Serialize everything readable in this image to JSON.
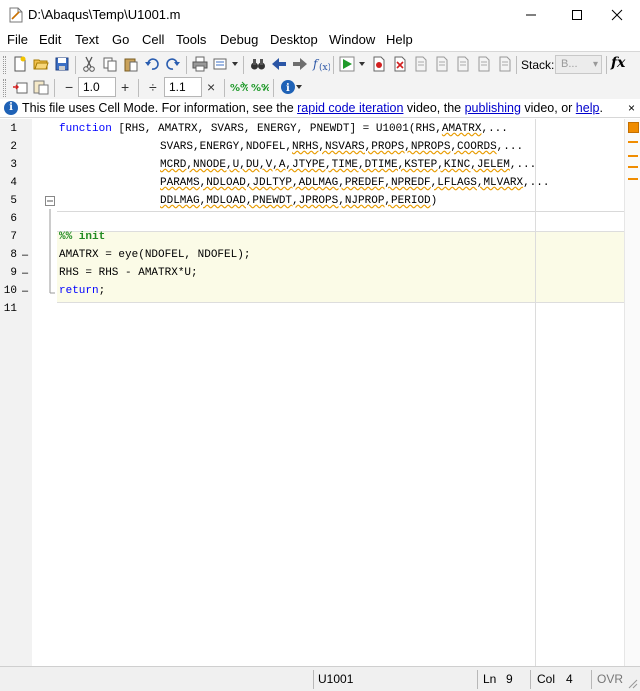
{
  "window": {
    "title": "D:\\Abaqus\\Temp\\U1001.m"
  },
  "menubar": [
    {
      "label": "File"
    },
    {
      "label": "Edit"
    },
    {
      "label": "Text"
    },
    {
      "label": "Go"
    },
    {
      "label": "Cell"
    },
    {
      "label": "Tools"
    },
    {
      "label": "Debug"
    },
    {
      "label": "Desktop"
    },
    {
      "label": "Window"
    },
    {
      "label": "Help"
    }
  ],
  "toolbar": {
    "stack_label": "Stack:",
    "stack_value": "B...",
    "fx_label": "fx"
  },
  "cell_toolbar": {
    "minus": "−",
    "field1": "1.0",
    "plus": "+",
    "divide": "÷",
    "field2": "1.1",
    "times": "×"
  },
  "infobar": {
    "text_prefix": "This file uses Cell Mode. For information, see the ",
    "link1": "rapid code iteration",
    "text_mid1": " video, the ",
    "link2": "publishing",
    "text_mid2": " video, or ",
    "link3": "help",
    "text_suffix": ".",
    "close": "×"
  },
  "editor": {
    "line_numbers": [
      "1",
      "2",
      "3",
      "4",
      "5",
      "6",
      "7",
      "8",
      "9",
      "10",
      "11"
    ],
    "lines": {
      "l1_kw": "function",
      "l1_a": " [RHS, AMATRX, SVARS, ENERGY, PNEWDT] = U1001(RHS,",
      "l1_b": "AMATRX",
      "l1_c": ",...",
      "l2_a": "SVARS,ENERGY,NDOFEL,",
      "l2_b": "NRHS,NSVARS,PROPS,NPROPS,COORDS",
      "l2_c": ",...",
      "l3_a": "MCRD,NNODE,U,DU,V,A,JTYPE,TIME,DTIME,KSTEP,KINC,JELEM",
      "l3_c": ",...",
      "l4_a": "PARAMS,NDLOAD,JDLTYP,ADLMAG,PREDEF,NPREDF,LFLAGS,MLVARX",
      "l4_c": ",...",
      "l5_a": "DDLMAG,MDLOAD,PNEWDT,JPROPS,NJPROP,PERIOD",
      "l5_c": ")",
      "l7": "%% init",
      "l8": "AMATRX = eye(NDOFEL, NDOFEL);",
      "l9": "RHS = RHS - AMATRX*U;",
      "l10": "return",
      "l10_b": ";"
    },
    "executable_marker": "–"
  },
  "statusbar": {
    "function_name": "U1001",
    "ln_label": "Ln",
    "ln_value": "9",
    "col_label": "Col",
    "col_value": "4",
    "ovr": "OVR"
  },
  "colors": {
    "keyword": "#0000ff",
    "cell_title": "#228b22",
    "cell_background": "#fbfbe7",
    "mlint_warning": "#f08c00",
    "link": "#0000cc"
  }
}
